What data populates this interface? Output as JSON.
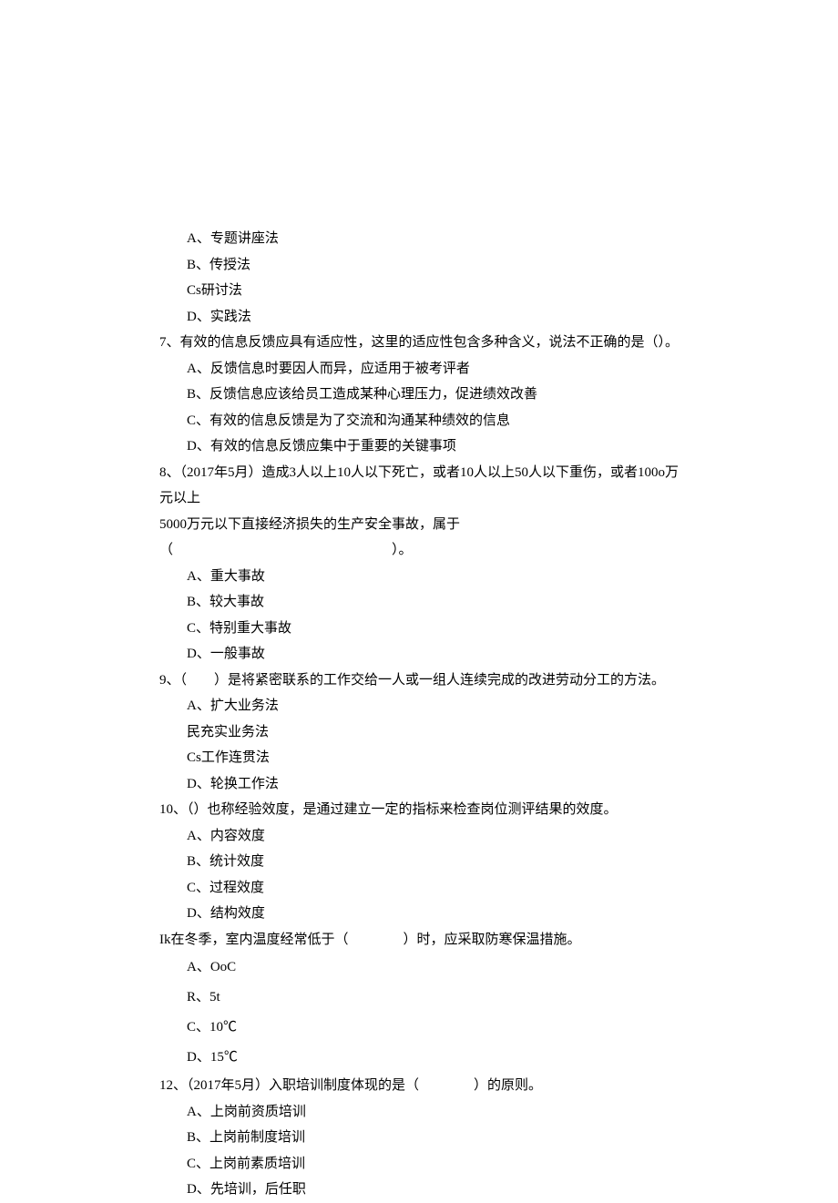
{
  "q6": {
    "optA": "A、专题讲座法",
    "optB": "B、传授法",
    "optC": "Cs研讨法",
    "optD": "D、实践法"
  },
  "q7": {
    "text": "7、有效的信息反馈应具有适应性，这里的适应性包含多种含义，说法不正确的是（）。",
    "optA": "A、反馈信息时要因人而异，应适用于被考评者",
    "optB": "B、反馈信息应该给员工造成某种心理压力，促进绩效改善",
    "optC": "C、有效的信息反馈是为了交流和沟通某种绩效的信息",
    "optD": "D、有效的信息反馈应集中于重要的关键事项"
  },
  "q8": {
    "line1": "8、（2017年5月）造成3人以上10人以下死亡，或者10人以上50人以下重伤，或者100o万元以上",
    "line2": "5000万元以下直接经济损失的生产安全事故，属于（　　　　　　　　　　　　　　　　）。",
    "optA": "A、重大事故",
    "optB": "B、较大事故",
    "optC": "C、特别重大事故",
    "optD": "D、一般事故"
  },
  "q9": {
    "text": "9、（　　）是将紧密联系的工作交给一人或一组人连续完成的改进劳动分工的方法。",
    "optA": "A、扩大业务法",
    "optB": "民充实业务法",
    "optC": "Cs工作连贯法",
    "optD": "D、轮换工作法"
  },
  "q10": {
    "text": "10、（）也称经验效度，是通过建立一定的指标来检查岗位测评结果的效度。",
    "optA": "A、内容效度",
    "optB": "B、统计效度",
    "optC": "C、过程效度",
    "optD": "D、结构效度"
  },
  "q11": {
    "text": "Ik在冬季，室内温度经常低于（　　　　）时，应采取防寒保温措施。",
    "optA": "A、OoC",
    "optB": "R、5t",
    "optC": "C、10℃",
    "optD": "D、15℃"
  },
  "q12": {
    "text": "12、（2017年5月）入职培训制度体现的是（　　　　）的原则。",
    "optA": "A、上岗前资质培训",
    "optB": "B、上岗前制度培训",
    "optC": "C、上岗前素质培训",
    "optD": "D、先培训，后任职"
  }
}
